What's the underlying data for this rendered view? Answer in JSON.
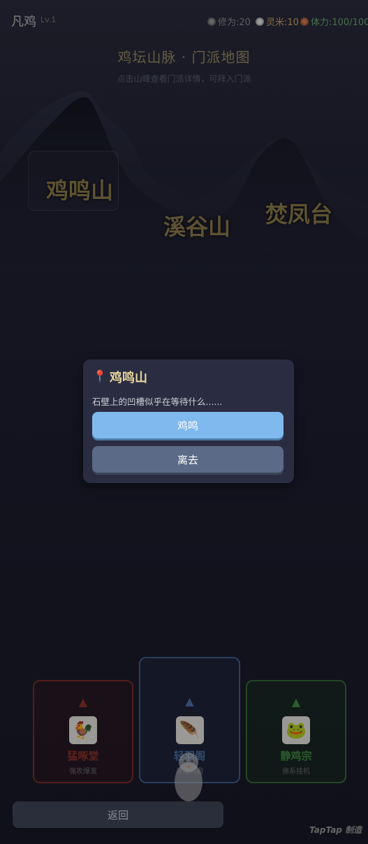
{
  "status": {
    "app_name": "凡鸡",
    "level": "Lv.1",
    "xiuwei": "修为:20",
    "lingmi": "灵米:10",
    "tili": "体力:100/100"
  },
  "map": {
    "title": "鸡坛山脉 · 门派地图",
    "subtitle": "点击山峰查看门派详情，可拜入门派",
    "peaks": [
      "鸡鸣山",
      "溪谷山",
      "焚凤台"
    ]
  },
  "dialog": {
    "title": "鸡鸣山",
    "text": "石壁上的凹槽似乎在等待什么......",
    "primary_label": "鸡鸣",
    "secondary_label": "离去"
  },
  "sects": [
    {
      "name": "猛啄堂",
      "tag": "强攻爆发",
      "icon": "rooster-icon",
      "color": "#8b2e22"
    },
    {
      "name": "轻羽阁",
      "tag": "身法闪避",
      "icon": "feather-icon",
      "color": "#4a6fa0"
    },
    {
      "name": "静鸡宗",
      "tag": "佛系挂机",
      "icon": "meditate-icon",
      "color": "#3c8a3c"
    }
  ],
  "back_label": "返回",
  "watermark": "TapTap 制造"
}
